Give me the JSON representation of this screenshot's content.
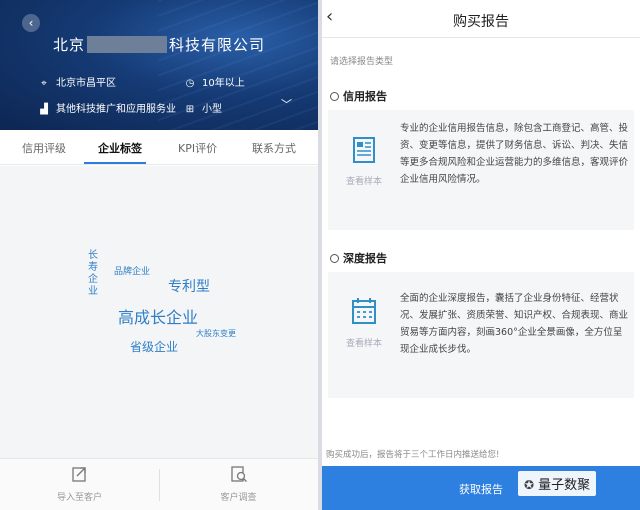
{
  "left": {
    "company_prefix": "北京",
    "company_suffix": "科技有限公司",
    "location": "北京市昌平区",
    "years": "10年以上",
    "industry": "其他科技推广和应用服务业",
    "size": "小型",
    "tabs": [
      "信用评级",
      "企业标签",
      "KPI评价",
      "联系方式"
    ],
    "active_tab": "企业标签",
    "tag_cloud": [
      {
        "text": "长寿企业"
      },
      {
        "text": "品牌企业"
      },
      {
        "text": "专利型"
      },
      {
        "text": "高成长企业"
      },
      {
        "text": "大股东变更"
      },
      {
        "text": "省级企业"
      }
    ],
    "bottom": {
      "import_label": "导入至客户",
      "survey_label": "客户调查"
    }
  },
  "right": {
    "title": "购买报告",
    "prompt": "请选择报告类型",
    "credit": {
      "heading": "信用报告",
      "sample": "查看样本",
      "desc": "专业的企业信用报告信息，除包含工商登记、高管、投资、变更等信息，提供了财务信息、诉讼、判决、失信等更多合规风险和企业运营能力的多维信息，客观评价企业信用风险情况。"
    },
    "deep": {
      "heading": "深度报告",
      "sample": "查看样本",
      "desc": "全面的企业深度报告，囊括了企业身份特征、经营状况、发展扩张、资质荣誉、知识产权、合规表现、商业贸易等方面内容，刻画360°企业全景画像，全方位呈现企业成长步伐。"
    },
    "notice": "购买成功后，报告将于三个工作日内推送给您!",
    "cta": "获取报告"
  },
  "watermark": "量子数聚",
  "colors": {
    "accent": "#2d7fe0",
    "hero": "#153a74",
    "tag": "#2f7fc6"
  }
}
